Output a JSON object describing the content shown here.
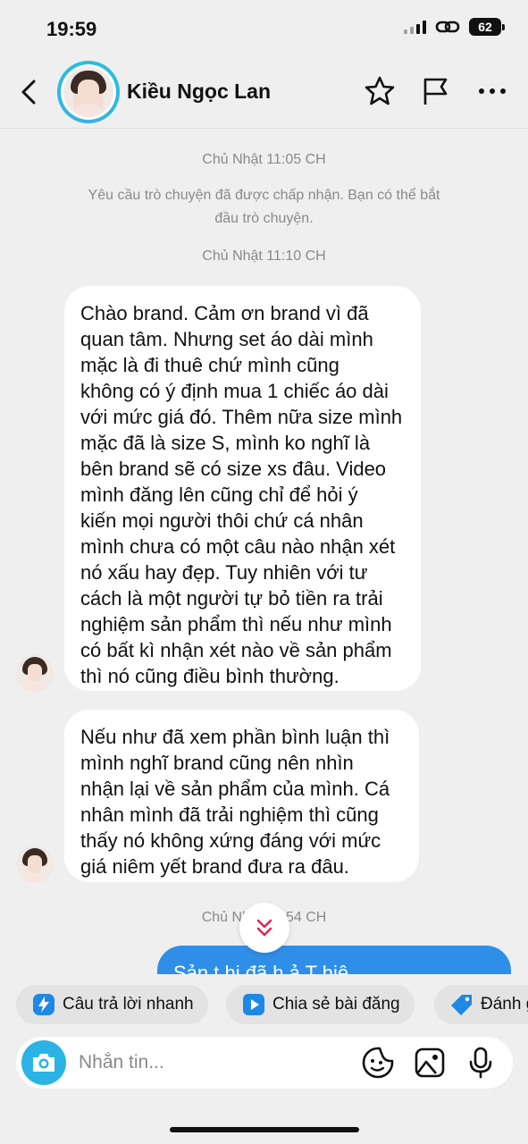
{
  "status_bar": {
    "time": "19:59",
    "battery": "62"
  },
  "header": {
    "contact_name": "Kiều Ngọc Lan"
  },
  "conversation": {
    "timestamp_1": "Chủ Nhật 11:05 CH",
    "system_message": "Yêu cầu trò chuyện đã được chấp nhận. Bạn có thể bắt\nđầu trò chuyện.",
    "timestamp_2": "Chủ Nhật 11:10 CH",
    "message_1": "Chào brand. Cảm ơn brand vì đã\nquan tâm. Nhưng set áo dài mình\nmặc là đi thuê chứ mình cũng\nkhông có ý định mua 1 chiếc áo dài\nvới mức giá đó. Thêm nữa size mình\nmặc đã là size S, mình ko nghĩ là\nbên brand sẽ có size xs đâu. Video\nmình đăng lên cũng chỉ để hỏi ý\nkiến mọi người thôi chứ cá nhân\nmình chưa có một câu nào nhận xét\nnó xấu hay đẹp. Tuy nhiên với tư\ncách là một người tự bỏ tiền ra trải\nnghiệm sản phẩm thì nếu như mình\ncó bất kì nhận xét nào về sản phẩm\nthì nó cũng điều bình thường.",
    "message_2": "Nếu như đã xem phần bình luận thì\nmình nghĩ brand cũng nên nhìn\nnhận lại về sản phẩm của mình. Cá\nnhân mình đã trải nghiệm thì cũng\nthấy nó không xứng đáng với mức\ngiá niêm yết brand đưa ra đâu.",
    "timestamp_3": "Chủ Nh        :54 CH",
    "outgoing_partial": "Sản  t    hị đã     h   ả  T    hiê"
  },
  "quick_actions": [
    {
      "label": "Câu trả lời nhanh",
      "icon": "lightning-icon"
    },
    {
      "label": "Chia sẻ bài đăng",
      "icon": "play-icon"
    },
    {
      "label": "Đánh g",
      "icon": "tag-icon"
    }
  ],
  "composer": {
    "placeholder": "Nhắn tin..."
  },
  "colors": {
    "accent": "#2bb3e6",
    "outgoing_bubble": "#2f8fe8",
    "background": "#efefef",
    "timestamp": "#8a8a8a"
  }
}
